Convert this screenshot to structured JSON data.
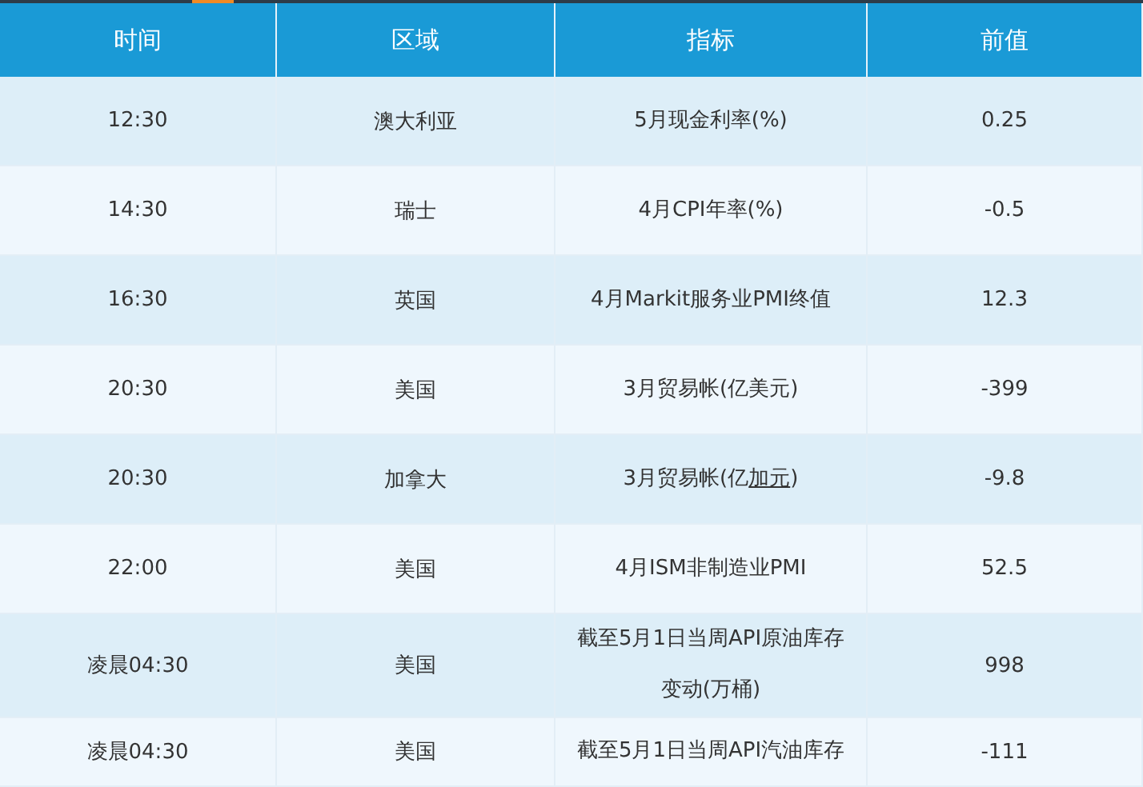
{
  "table": {
    "columns": [
      "时间",
      "区域",
      "指标",
      "前值"
    ],
    "rows": [
      {
        "time": "12:30",
        "region": "澳大利亚",
        "indicator": [
          [
            {
              "text": "5月现金利率(%)",
              "link": false
            }
          ]
        ],
        "previous": "0.25"
      },
      {
        "time": "14:30",
        "region": "瑞士",
        "indicator": [
          [
            {
              "text": "4月CPI年率(%)",
              "link": false
            }
          ]
        ],
        "previous": "-0.5"
      },
      {
        "time": "16:30",
        "region": "英国",
        "indicator": [
          [
            {
              "text": "4月Markit服务业PMI终值",
              "link": false
            }
          ]
        ],
        "previous": "12.3"
      },
      {
        "time": "20:30",
        "region": "美国",
        "indicator": [
          [
            {
              "text": "3月贸易帐(亿美元)",
              "link": false
            }
          ]
        ],
        "previous": "-399"
      },
      {
        "time": "20:30",
        "region": "加拿大",
        "indicator": [
          [
            {
              "text": "3月贸易帐(亿",
              "link": false
            },
            {
              "text": "加元",
              "link": true
            },
            {
              "text": ")",
              "link": false
            }
          ]
        ],
        "previous": "-9.8"
      },
      {
        "time": "22:00",
        "region": "美国",
        "indicator": [
          [
            {
              "text": "4月ISM非制造业PMI",
              "link": false
            }
          ]
        ],
        "previous": "52.5"
      },
      {
        "time": "凌晨04:30",
        "region": "美国",
        "indicator": [
          [
            {
              "text": "截至5月1日当周API原油库存",
              "link": false
            }
          ],
          [
            {
              "text": "变动(万桶)",
              "link": false
            }
          ]
        ],
        "previous": "998"
      },
      {
        "time": "凌晨04:30",
        "region": "美国",
        "indicator": [
          [
            {
              "text": "截至5月1日当周API汽油库存",
              "link": false
            }
          ]
        ],
        "previous": "-111"
      }
    ]
  }
}
